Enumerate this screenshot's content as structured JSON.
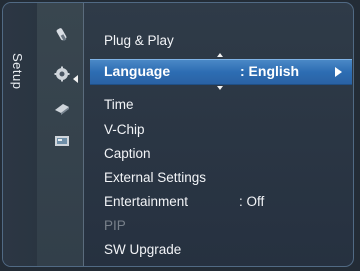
{
  "side_tab": {
    "label": "Setup"
  },
  "icons": [
    {
      "name": "picture-icon"
    },
    {
      "name": "setup-gear-icon"
    },
    {
      "name": "input-icon"
    },
    {
      "name": "application-icon"
    }
  ],
  "menu": {
    "items": [
      {
        "label": "Plug & Play",
        "value": "",
        "enabled": true
      },
      {
        "label": "Language",
        "value": ": English",
        "enabled": true,
        "selected": true
      },
      {
        "label": "Time",
        "value": "",
        "enabled": true
      },
      {
        "label": "V-Chip",
        "value": "",
        "enabled": true
      },
      {
        "label": "Caption",
        "value": "",
        "enabled": true
      },
      {
        "label": "External Settings",
        "value": "",
        "enabled": true
      },
      {
        "label": "Entertainment",
        "value": ": Off",
        "enabled": true
      },
      {
        "label": "PIP",
        "value": "",
        "enabled": false
      },
      {
        "label": "SW Upgrade",
        "value": "",
        "enabled": true
      }
    ]
  },
  "colors": {
    "background": "#2f3b48",
    "highlight": "#2d6db3",
    "text": "#f2f4f7",
    "disabled_text": "#78808a"
  }
}
